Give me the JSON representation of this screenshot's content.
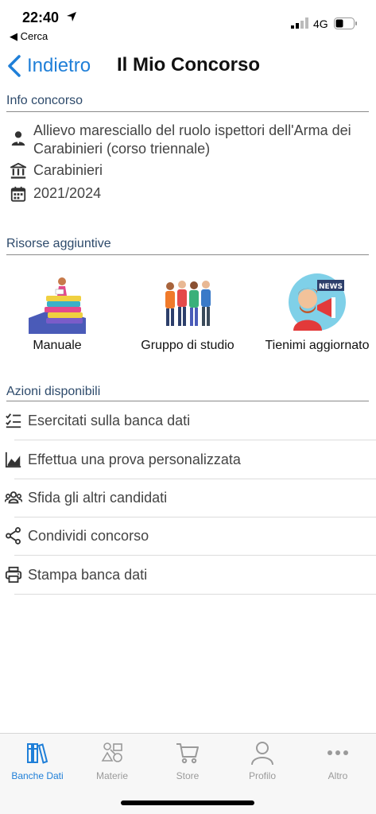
{
  "status_bar": {
    "time": "22:40",
    "back_app": "◀ Cerca",
    "network": "4G"
  },
  "nav": {
    "back_label": "Indietro",
    "title": "Il Mio Concorso"
  },
  "info": {
    "header": "Info concorso",
    "rows": [
      {
        "icon": "person-icon",
        "text": "Allievo maresciallo del ruolo ispettori dell'Arma dei Carabinieri (corso triennale)"
      },
      {
        "icon": "building-icon",
        "text": "Carabinieri"
      },
      {
        "icon": "calendar-icon",
        "text": "2021/2024"
      }
    ]
  },
  "resources": {
    "header": "Risorse aggiuntive",
    "items": [
      {
        "icon": "books-illustration",
        "label": "Manuale"
      },
      {
        "icon": "study-group-illustration",
        "label": "Gruppo di studio"
      },
      {
        "icon": "news-megaphone-illustration",
        "label": "Tienimi aggiornato"
      }
    ]
  },
  "actions": {
    "header": "Azioni disponibili",
    "items": [
      {
        "icon": "checklist-icon",
        "label": "Esercitati sulla banca dati"
      },
      {
        "icon": "chart-icon",
        "label": "Effettua una prova personalizzata"
      },
      {
        "icon": "group-icon",
        "label": "Sfida gli altri candidati"
      },
      {
        "icon": "share-icon",
        "label": "Condividi concorso"
      },
      {
        "icon": "print-icon",
        "label": "Stampa banca dati"
      }
    ]
  },
  "tabbar": {
    "items": [
      {
        "icon": "books-tab-icon",
        "label": "Banche Dati",
        "active": true
      },
      {
        "icon": "subjects-tab-icon",
        "label": "Materie",
        "active": false
      },
      {
        "icon": "cart-icon",
        "label": "Store",
        "active": false
      },
      {
        "icon": "profile-icon",
        "label": "Profilo",
        "active": false
      },
      {
        "icon": "more-icon",
        "label": "Altro",
        "active": false
      }
    ]
  },
  "colors": {
    "accent": "#1f7fd8",
    "section_header": "#2d4a6b",
    "text": "#444444"
  }
}
